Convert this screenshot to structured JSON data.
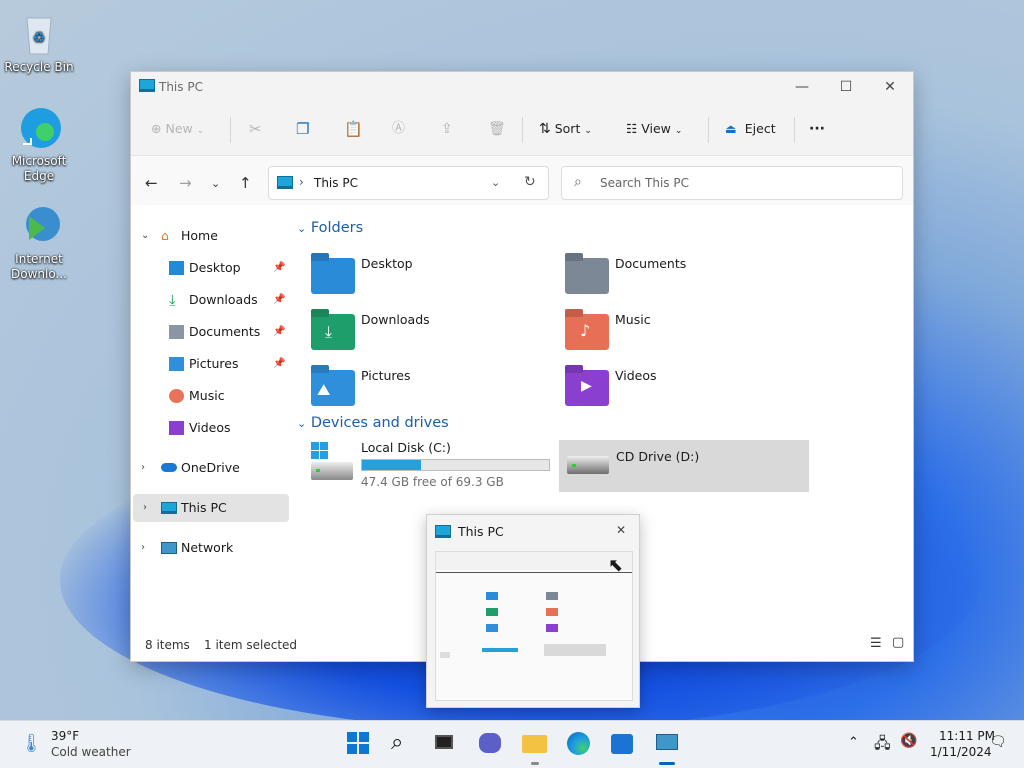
{
  "desktop": {
    "icons": [
      {
        "label": "Recycle Bin"
      },
      {
        "label": "Microsoft Edge"
      },
      {
        "label": "Internet Downlo..."
      }
    ]
  },
  "window": {
    "title": "This PC",
    "controls": {
      "minimize": "—",
      "maximize": "☐",
      "close": "✕"
    },
    "toolbar": {
      "new_label": "New",
      "sort_label": "Sort",
      "view_label": "View",
      "eject_label": "Eject",
      "more_label": "···"
    },
    "address": {
      "location": "This PC",
      "search_placeholder": "Search This PC"
    },
    "nav": {
      "home": "Home",
      "quick": [
        {
          "label": "Desktop"
        },
        {
          "label": "Downloads"
        },
        {
          "label": "Documents"
        },
        {
          "label": "Pictures"
        },
        {
          "label": "Music"
        },
        {
          "label": "Videos"
        }
      ],
      "onedrive": "OneDrive",
      "thispc": "This PC",
      "network": "Network"
    },
    "folders_header": "Folders",
    "folders": [
      {
        "label": "Desktop"
      },
      {
        "label": "Documents"
      },
      {
        "label": "Downloads"
      },
      {
        "label": "Music"
      },
      {
        "label": "Pictures"
      },
      {
        "label": "Videos"
      }
    ],
    "drives_header": "Devices and drives",
    "drives": [
      {
        "label": "Local Disk (C:)",
        "free_text": "47.4 GB free of 69.3 GB",
        "used_fraction": 0.316
      },
      {
        "label": "CD Drive (D:)"
      }
    ],
    "status": {
      "items": "8 items",
      "selected": "1 item selected"
    }
  },
  "preview": {
    "title": "This PC",
    "close": "✕"
  },
  "taskbar": {
    "weather_temp": "39°F",
    "weather_desc": "Cold weather",
    "time": "11:11 PM",
    "date": "1/11/2024"
  },
  "colors": {
    "accent": "#0067c0",
    "folder_blue": "#2a8bd8",
    "drive_bar": "#26a0da"
  }
}
